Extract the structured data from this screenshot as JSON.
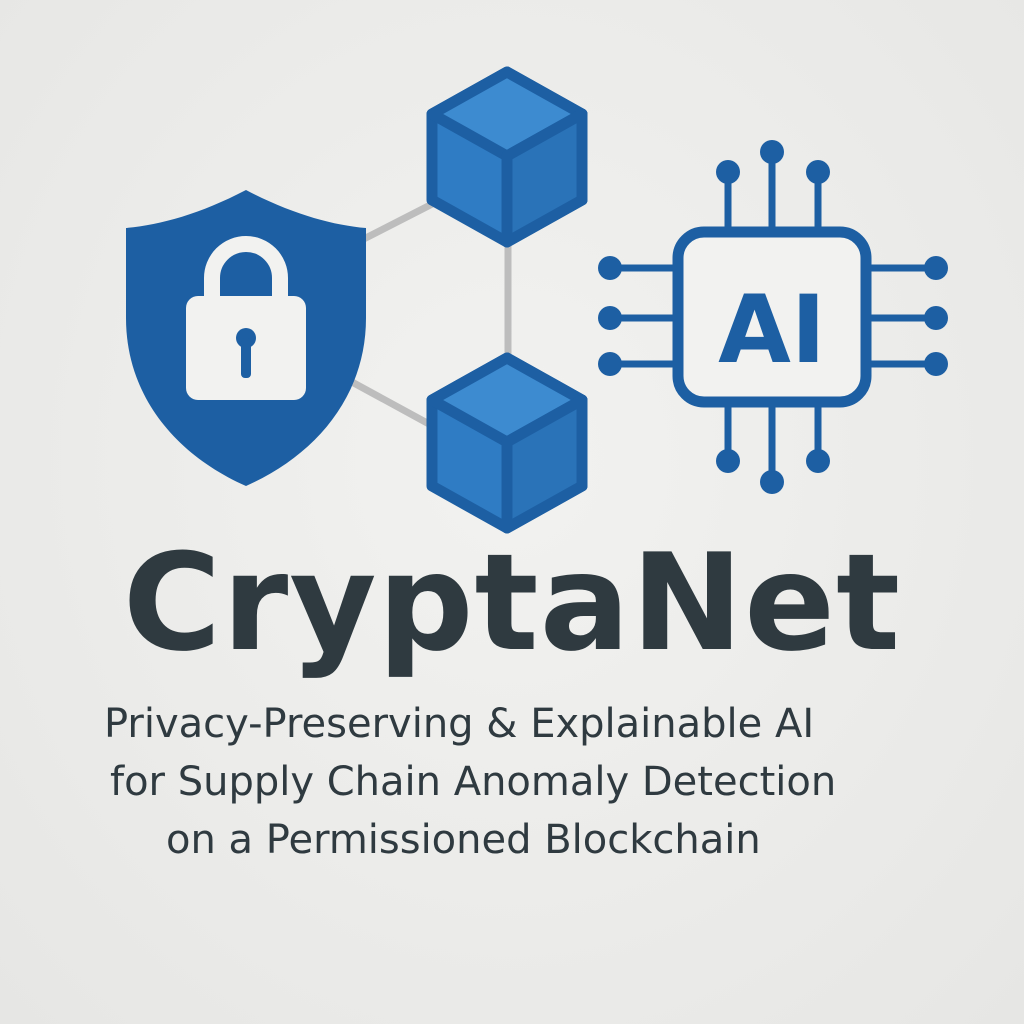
{
  "brand": {
    "name": "CryptaNet",
    "tagline_lines": [
      "Privacy-Preserving & Explainable AI",
      "for Supply Chain Anomaly Detection",
      "on a Permissioned Blockchain"
    ],
    "chip_label": "AI"
  },
  "icons": {
    "shield": "shield-lock-icon",
    "blockchain": "blockchain-cubes-icon",
    "chip": "ai-chip-icon"
  },
  "colors": {
    "primary_blue": "#1d5fa3",
    "cube_face_blue": "#2f7cc4",
    "connector_gray": "#bdbdbd",
    "text_dark": "#2f3a40",
    "background": "#ebebe9"
  }
}
